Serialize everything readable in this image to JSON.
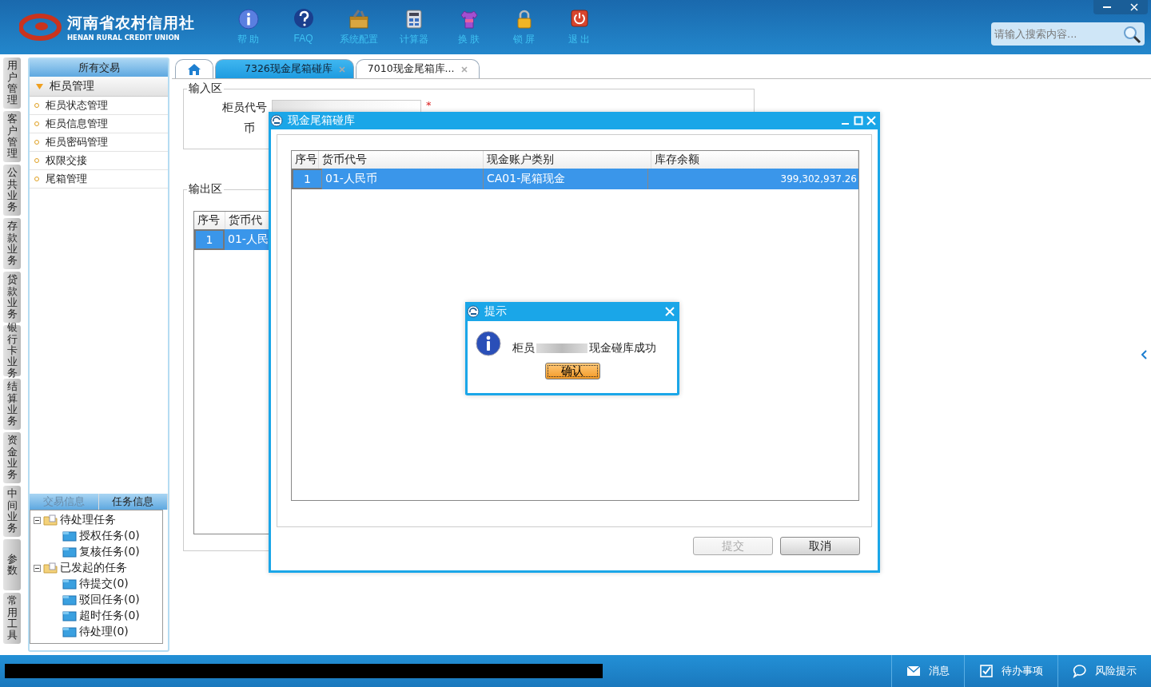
{
  "header": {
    "logo_title": "河南省农村信用社",
    "logo_subtitle": "HENAN RURAL CREDIT UNION",
    "tools": [
      {
        "label": "帮 助",
        "kind": "help"
      },
      {
        "label": "FAQ",
        "kind": "faq"
      },
      {
        "label": "系统配置",
        "kind": "config"
      },
      {
        "label": "计算器",
        "kind": "calculator"
      },
      {
        "label": "换 肤",
        "kind": "skin"
      },
      {
        "label": "锁 屏",
        "kind": "lock"
      },
      {
        "label": "退 出",
        "kind": "exit"
      }
    ],
    "search": {
      "placeholder": "请输入搜索内容..."
    }
  },
  "side_tabs": [
    "用户管理",
    "客户管理",
    "公共业务",
    "存款业务",
    "贷款业务",
    "银行卡业务",
    "结算业务",
    "资金业务",
    "中间业务",
    "参数",
    "常用工具"
  ],
  "sidebar": {
    "title": "所有交易",
    "group": {
      "label": "柜员管理",
      "expanded": true,
      "items": [
        "柜员状态管理",
        "柜员信息管理",
        "柜员密码管理",
        "权限交接",
        "尾箱管理"
      ]
    },
    "bottom_tabs": [
      {
        "label": "交易信息",
        "selected": false
      },
      {
        "label": "任务信息",
        "selected": true
      }
    ],
    "tree": [
      {
        "label": "待处理任务",
        "expanded": true,
        "children": [
          {
            "label": "授权任务(0)"
          },
          {
            "label": "复核任务(0)"
          }
        ]
      },
      {
        "label": "已发起的任务",
        "expanded": true,
        "children": [
          {
            "label": "待提交(0)"
          },
          {
            "label": "驳回任务(0)"
          },
          {
            "label": "超时任务(0)"
          },
          {
            "label": "待处理(0)"
          }
        ]
      }
    ]
  },
  "tabs": [
    {
      "kind": "home",
      "selected": false
    },
    {
      "kind": "page",
      "label": "7326现金尾箱碰库",
      "selected": true
    },
    {
      "kind": "page",
      "label": "7010现金尾箱库...",
      "selected": false
    }
  ],
  "input_section": {
    "title": "输入区",
    "fields": [
      {
        "label": "柜员代号",
        "marker": "*"
      },
      {
        "label": "币"
      }
    ]
  },
  "output_section": {
    "title": "输出区",
    "columns": [
      "序号",
      "货币代"
    ],
    "rows": [
      {
        "cells": [
          "1",
          "01-人民"
        ],
        "selected": true
      }
    ]
  },
  "dialog": {
    "title": "现金尾箱碰库",
    "columns": [
      "序号",
      "货币代号",
      "现金账户类别",
      "库存余额"
    ],
    "rows": [
      {
        "cells": [
          "1",
          "01-人民币",
          "CA01-尾箱现金",
          "399,302,937.26"
        ],
        "selected": true
      }
    ],
    "buttons": [
      {
        "label": "提交",
        "disabled": true
      },
      {
        "label": "取消",
        "disabled": false
      }
    ]
  },
  "alert": {
    "title": "提示",
    "message_prefix": "柜员",
    "message_suffix": "现金碰库成功",
    "button": "确认"
  },
  "status_bar": {
    "items": [
      {
        "label": "消息",
        "kind": "mail"
      },
      {
        "label": "待办事项",
        "kind": "check"
      },
      {
        "label": "风险提示",
        "kind": "chat"
      }
    ]
  }
}
